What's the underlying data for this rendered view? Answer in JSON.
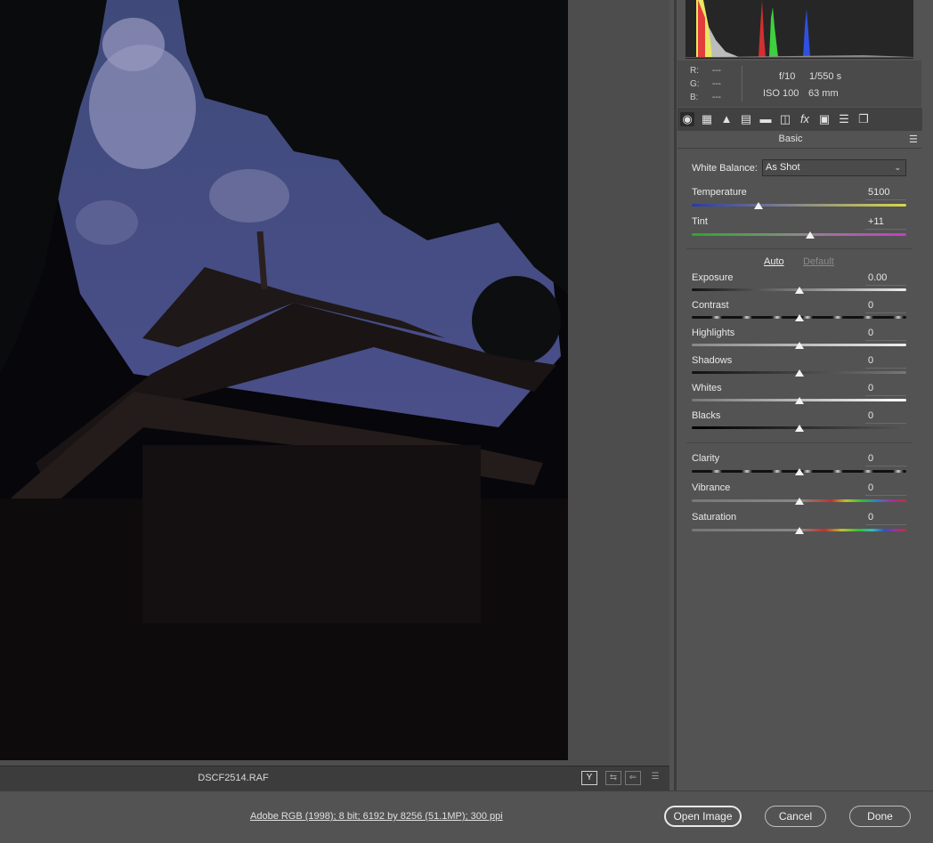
{
  "preview": {
    "filename": "DSCF2514.RAF",
    "view_toggle": "Y"
  },
  "readout": {
    "r_label": "R:",
    "g_label": "G:",
    "b_label": "B:",
    "r_value": "---",
    "g_value": "---",
    "b_value": "---",
    "aperture": "f/10",
    "shutter": "1/550 s",
    "iso": "ISO 100",
    "focal": "63 mm"
  },
  "toolbar": {
    "icons": [
      "basic-icon",
      "tone-curve-icon",
      "detail-icon",
      "hsl-icon",
      "split-toning-icon",
      "lens-corrections-icon",
      "effects-icon",
      "camera-calibration-icon",
      "presets-icon",
      "snapshots-icon"
    ]
  },
  "panel": {
    "section_title": "Basic",
    "white_balance_label": "White Balance:",
    "white_balance_value": "As Shot",
    "auto_label": "Auto",
    "default_label": "Default",
    "sliders": [
      {
        "label": "Temperature",
        "value": "5100",
        "level": 0.31
      },
      {
        "label": "Tint",
        "value": "+11",
        "level": 0.55
      },
      {
        "label": "Exposure",
        "value": "0.00",
        "level": 0.5
      },
      {
        "label": "Contrast",
        "value": "0",
        "level": 0.5
      },
      {
        "label": "Highlights",
        "value": "0",
        "level": 0.5
      },
      {
        "label": "Shadows",
        "value": "0",
        "level": 0.5
      },
      {
        "label": "Whites",
        "value": "0",
        "level": 0.5
      },
      {
        "label": "Blacks",
        "value": "0",
        "level": 0.5
      },
      {
        "label": "Clarity",
        "value": "0",
        "level": 0.5
      },
      {
        "label": "Vibrance",
        "value": "0",
        "level": 0.5
      },
      {
        "label": "Saturation",
        "value": "0",
        "level": 0.5
      }
    ]
  },
  "footer": {
    "doc_info": "Adobe RGB (1998); 8 bit; 6192 by 8256 (51.1MP); 300 ppi",
    "open_label": "Open Image",
    "cancel_label": "Cancel",
    "done_label": "Done"
  }
}
